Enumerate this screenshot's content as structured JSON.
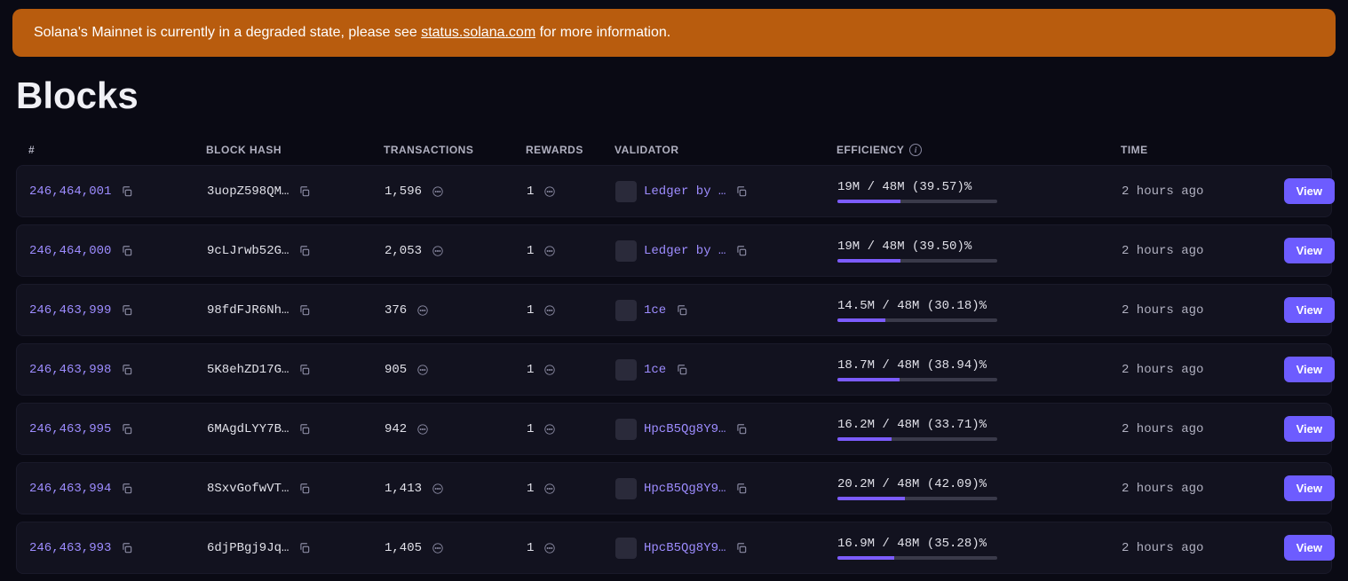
{
  "banner": {
    "text_before": "Solana's Mainnet is currently in a degraded state, please see ",
    "link_text": "status.solana.com",
    "text_after": " for more information."
  },
  "page_title": "Blocks",
  "columns": {
    "num": "#",
    "hash": "BLOCK HASH",
    "tx": "TRANSACTIONS",
    "rewards": "REWARDS",
    "validator": "VALIDATOR",
    "efficiency": "EFFICIENCY",
    "time": "TIME"
  },
  "view_label": "View",
  "rows": [
    {
      "num": "246,464,001",
      "hash": "3uopZ598QM…",
      "tx": "1,596",
      "rewards": "1",
      "validator": "Ledger by …",
      "eff_text": "19M / 48M (39.57)%",
      "eff_pct": 39.57,
      "time": "2 hours ago"
    },
    {
      "num": "246,464,000",
      "hash": "9cLJrwb52G…",
      "tx": "2,053",
      "rewards": "1",
      "validator": "Ledger by …",
      "eff_text": "19M / 48M (39.50)%",
      "eff_pct": 39.5,
      "time": "2 hours ago"
    },
    {
      "num": "246,463,999",
      "hash": "98fdFJR6Nh…",
      "tx": "376",
      "rewards": "1",
      "validator": "1ce",
      "eff_text": "14.5M / 48M (30.18)%",
      "eff_pct": 30.18,
      "time": "2 hours ago"
    },
    {
      "num": "246,463,998",
      "hash": "5K8ehZD17G…",
      "tx": "905",
      "rewards": "1",
      "validator": "1ce",
      "eff_text": "18.7M / 48M (38.94)%",
      "eff_pct": 38.94,
      "time": "2 hours ago"
    },
    {
      "num": "246,463,995",
      "hash": "6MAgdLYY7B…",
      "tx": "942",
      "rewards": "1",
      "validator": "HpcB5Qg8Y9…",
      "eff_text": "16.2M / 48M (33.71)%",
      "eff_pct": 33.71,
      "time": "2 hours ago"
    },
    {
      "num": "246,463,994",
      "hash": "8SxvGofwVT…",
      "tx": "1,413",
      "rewards": "1",
      "validator": "HpcB5Qg8Y9…",
      "eff_text": "20.2M / 48M (42.09)%",
      "eff_pct": 42.09,
      "time": "2 hours ago"
    },
    {
      "num": "246,463,993",
      "hash": "6djPBgj9Jq…",
      "tx": "1,405",
      "rewards": "1",
      "validator": "HpcB5Qg8Y9…",
      "eff_text": "16.9M / 48M (35.28)%",
      "eff_pct": 35.28,
      "time": "2 hours ago"
    }
  ]
}
